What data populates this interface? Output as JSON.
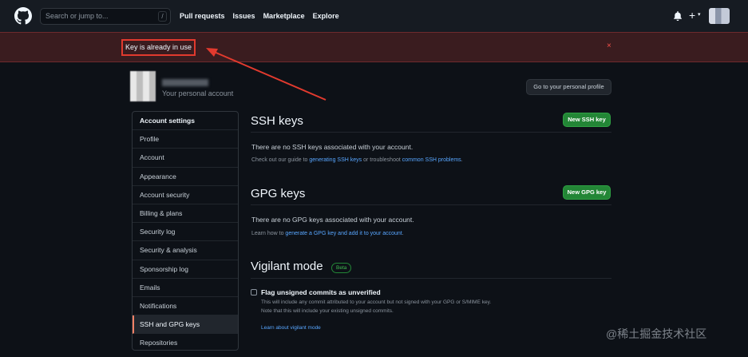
{
  "header": {
    "search_placeholder": "Search or jump to...",
    "search_shortcut": "/",
    "nav": [
      "Pull requests",
      "Issues",
      "Marketplace",
      "Explore"
    ],
    "plus": "+",
    "caret": "▾"
  },
  "flash": {
    "message": "Key is already in use",
    "close": "×"
  },
  "profile": {
    "subtitle": "Your personal account",
    "go_button": "Go to your personal profile"
  },
  "sidebar": {
    "items": [
      "Account settings",
      "Profile",
      "Account",
      "Appearance",
      "Account security",
      "Billing & plans",
      "Security log",
      "Security & analysis",
      "Sponsorship log",
      "Emails",
      "Notifications",
      "SSH and GPG keys",
      "Repositories"
    ],
    "active": "SSH and GPG keys"
  },
  "ssh": {
    "title": "SSH keys",
    "button": "New SSH key",
    "empty": "There are no SSH keys associated with your account.",
    "note_prefix": "Check out our guide to ",
    "note_link1": "generating SSH keys",
    "note_mid": " or troubleshoot ",
    "note_link2": "common SSH problems",
    "note_suffix": "."
  },
  "gpg": {
    "title": "GPG keys",
    "button": "New GPG key",
    "empty": "There are no GPG keys associated with your account.",
    "note_prefix": "Learn how to ",
    "note_link": "generate a GPG key and add it to your account",
    "note_suffix": "."
  },
  "vigilant": {
    "title": "Vigilant mode",
    "badge": "Beta",
    "checkbox_label": "Flag unsigned commits as unverified",
    "desc1": "This will include any commit attributed to your account but not signed with your GPG or S/MIME key.",
    "desc2": "Note that this will include your existing unsigned commits.",
    "link": "Learn about vigilant mode",
    "checked": false
  },
  "watermark": "@稀土掘金技术社区",
  "colors": {
    "accent_green": "#238636",
    "link": "#58a6ff",
    "flash_bg": "#3a1c1f",
    "annotation_red": "#e23a2e"
  }
}
